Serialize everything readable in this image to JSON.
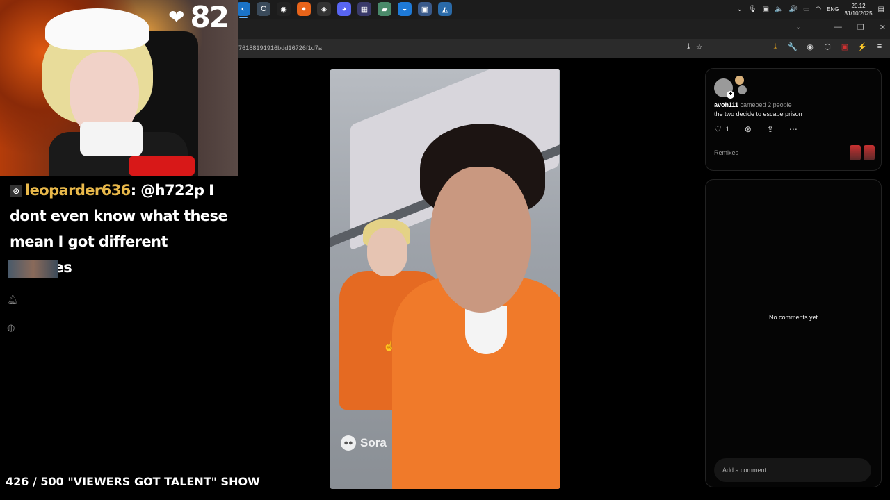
{
  "taskbar": {
    "apps": [
      {
        "icon": "edge-icon",
        "glyph": "◐",
        "color": "#1a73c8"
      },
      {
        "icon": "ccleaner-icon",
        "glyph": "C",
        "color": "#3a4a5a"
      },
      {
        "icon": "obs-icon",
        "glyph": "◉",
        "color": "#222"
      },
      {
        "icon": "firefox-icon",
        "glyph": "●",
        "color": "#e8641a"
      },
      {
        "icon": "maps-icon",
        "glyph": "◈",
        "color": "#333"
      },
      {
        "icon": "discord-icon",
        "glyph": "◕",
        "color": "#5865f2"
      },
      {
        "icon": "app-icon",
        "glyph": "▦",
        "color": "#3a3a6a"
      },
      {
        "icon": "notes-icon",
        "glyph": "▰",
        "color": "#4a8a6a"
      },
      {
        "icon": "browser-icon",
        "glyph": "◒",
        "color": "#1e7ad8"
      },
      {
        "icon": "explorer-icon",
        "glyph": "▣",
        "color": "#3a5a8a"
      },
      {
        "icon": "store-icon",
        "glyph": "◭",
        "color": "#2a6aa8"
      }
    ],
    "lang": "ENG",
    "time": "20.12",
    "date": "31/10/2025"
  },
  "browser": {
    "url_fragment": "76188191916bdd16726f1d7a"
  },
  "stream": {
    "heart_count": "82",
    "chat": {
      "username": "leoparder636",
      "separator": ":",
      "message": "@h722p I dont even know what these mean I got different hobbies"
    },
    "bottom_title": "426 / 500 \"VIEWERS GOT TALENT\" SHOW"
  },
  "video": {
    "watermark": "Sora"
  },
  "post": {
    "username": "avoh111",
    "cameo_text": "cameoed 2 people",
    "caption": "the two decide to escape prison",
    "like_count": "1",
    "remixes_label": "Remixes"
  },
  "comments": {
    "empty_text": "No comments yet",
    "placeholder": "Add a comment..."
  }
}
